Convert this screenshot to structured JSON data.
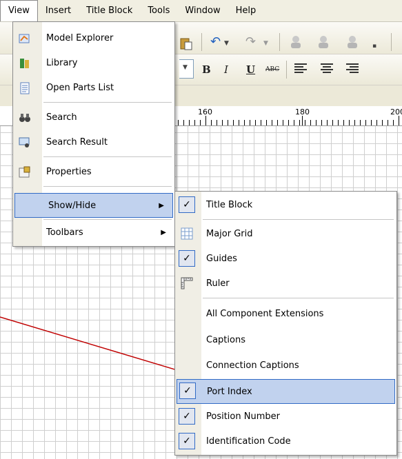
{
  "menubar": {
    "items": [
      "View",
      "Insert",
      "Title Block",
      "Tools",
      "Window",
      "Help"
    ],
    "active_index": 0
  },
  "toolbar": {
    "bold": "B",
    "italic": "I",
    "underline": "U",
    "strike": "ABC"
  },
  "ruler": {
    "labels": [
      "160",
      "180",
      "200"
    ]
  },
  "view_menu": {
    "items": [
      {
        "label": "Model Explorer",
        "icon": "model-explorer-icon"
      },
      {
        "label": "Library",
        "icon": "library-icon"
      },
      {
        "label": "Open Parts List",
        "icon": "parts-list-icon"
      },
      {
        "label": "Search",
        "icon": "binoculars-icon"
      },
      {
        "label": "Search Result",
        "icon": "search-result-icon"
      },
      {
        "label": "Properties",
        "icon": "properties-icon"
      },
      {
        "label": "Show/Hide",
        "submenu": true,
        "highlighted": true
      },
      {
        "label": "Toolbars",
        "submenu": true
      }
    ]
  },
  "show_hide_menu": {
    "items": [
      {
        "label": "Title Block",
        "checked": true
      },
      {
        "label": "Major Grid",
        "icon": "grid-icon"
      },
      {
        "label": "Guides",
        "checked": true
      },
      {
        "label": "Ruler",
        "icon": "ruler-icon"
      },
      {
        "label": "All Component Extensions"
      },
      {
        "label": "Captions"
      },
      {
        "label": "Connection Captions"
      },
      {
        "label": "Port Index",
        "checked": true,
        "highlighted": true
      },
      {
        "label": "Position Number",
        "checked": true
      },
      {
        "label": "Identification Code",
        "checked": true
      }
    ]
  },
  "colors": {
    "highlight_bg": "#c1d2ee",
    "highlight_border": "#316ac5",
    "annotation_line": "#c00000"
  }
}
